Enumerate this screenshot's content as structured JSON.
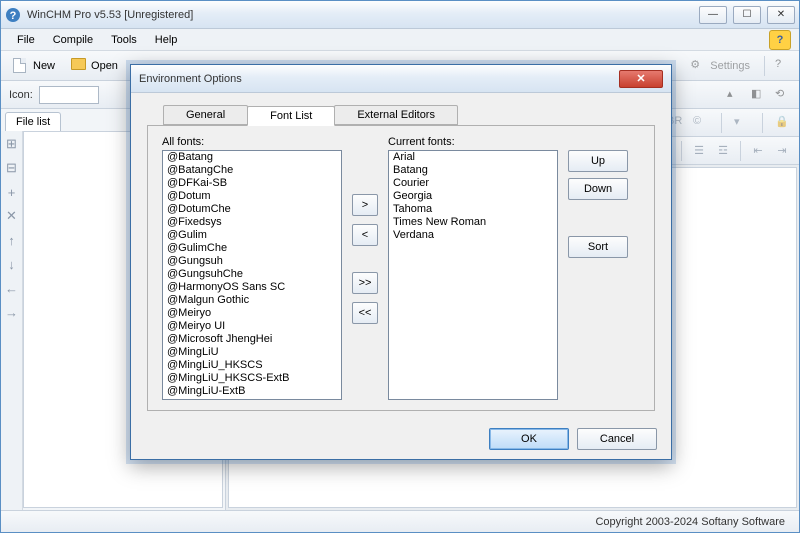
{
  "window": {
    "title": "WinCHM Pro v5.53 [Unregistered]"
  },
  "menu": {
    "file": "File",
    "compile": "Compile",
    "tools": "Tools",
    "help": "Help"
  },
  "toolbar": {
    "new": "New",
    "open": "Open",
    "settings": "Settings"
  },
  "iconbar": {
    "icon_label": "Icon:"
  },
  "left": {
    "tab_filelist": "File list"
  },
  "fmt": {
    "br": "BR",
    "copyright": "©"
  },
  "status": {
    "copyright": "Copyright 2003-2024 Softany Software"
  },
  "dialog": {
    "title": "Environment Options",
    "tabs": {
      "general": "General",
      "fontlist": "Font List",
      "external": "External Editors"
    },
    "labels": {
      "allfonts": "All fonts:",
      "currentfonts": "Current fonts:"
    },
    "buttons": {
      "up": "Up",
      "down": "Down",
      "sort": "Sort",
      "add": ">",
      "remove": "<",
      "addall": ">>",
      "removeall": "<<",
      "ok": "OK",
      "cancel": "Cancel"
    },
    "all_fonts": [
      "@Batang",
      "@BatangChe",
      "@DFKai-SB",
      "@Dotum",
      "@DotumChe",
      "@Fixedsys",
      "@Gulim",
      "@GulimChe",
      "@Gungsuh",
      "@GungsuhChe",
      "@HarmonyOS Sans SC",
      "@Malgun Gothic",
      "@Meiryo",
      "@Meiryo UI",
      "@Microsoft JhengHei",
      "@MingLiU",
      "@MingLiU_HKSCS",
      "@MingLiU_HKSCS-ExtB",
      "@MingLiU-ExtB"
    ],
    "current_fonts": [
      "Arial",
      "Batang",
      "Courier",
      "Georgia",
      "Tahoma",
      "Times New Roman",
      "Verdana"
    ]
  }
}
